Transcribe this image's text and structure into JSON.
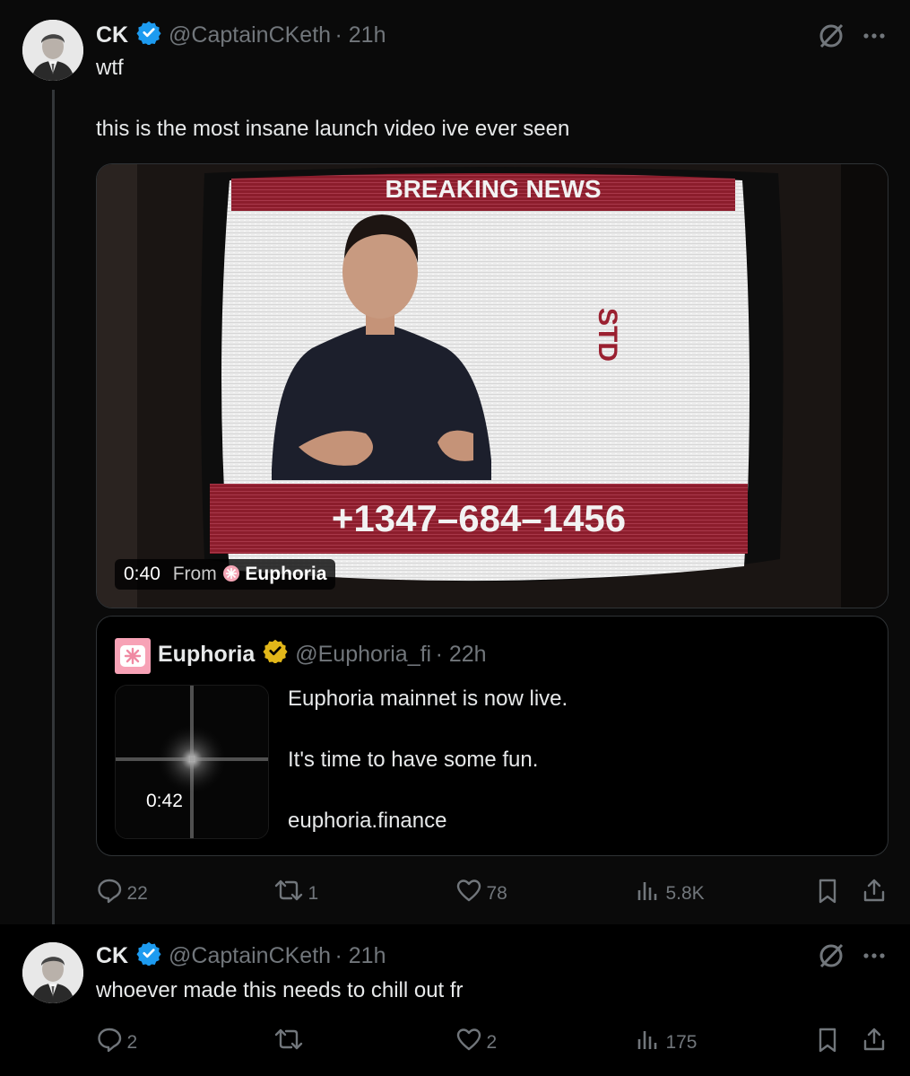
{
  "post1": {
    "author_name": "CK",
    "author_handle": "@CaptainCKeth",
    "time": "· 21h",
    "text_line1": "wtf",
    "text_line2": "this is the most insane launch video ive ever seen",
    "video": {
      "banner_top": "BREAKING NEWS",
      "banner_bottom": "+1347–684–1456",
      "side_text": "STD",
      "duration": "0:40",
      "from_label": "From",
      "from_name": "Euphoria"
    },
    "quote": {
      "author_name": "Euphoria",
      "author_handle": "@Euphoria_fi",
      "time": "· 22h",
      "thumb_duration": "0:42",
      "line1": "Euphoria mainnet is now live.",
      "line2": "It's time to have some fun.",
      "line3": "euphoria.finance"
    },
    "actions": {
      "replies": "22",
      "reposts": "1",
      "likes": "78",
      "views": "5.8K"
    }
  },
  "post2": {
    "author_name": "CK",
    "author_handle": "@CaptainCKeth",
    "time": "· 21h",
    "text": "whoever made this needs to chill out fr",
    "actions": {
      "replies": "2",
      "reposts": "",
      "likes": "2",
      "views": "175"
    }
  },
  "colors": {
    "accent_verified": "#1d9bf0",
    "gold_verified": "#e2b719",
    "banner_red": "#8e1f2e",
    "muted": "#71767b"
  }
}
